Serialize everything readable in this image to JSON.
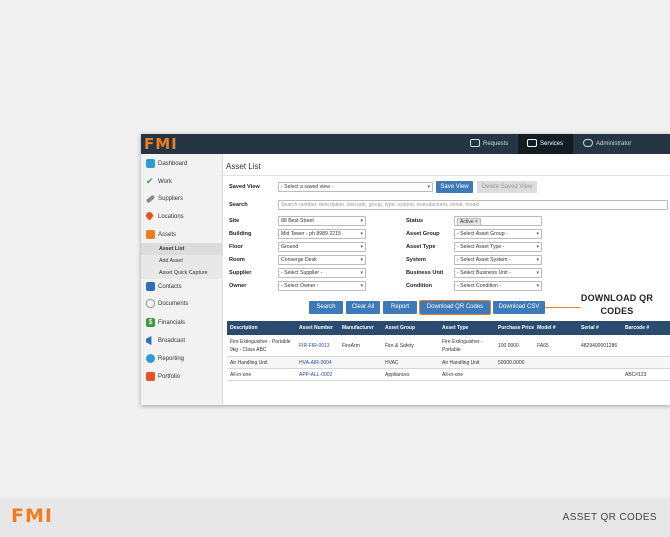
{
  "app": {
    "logo": "FMI",
    "nav": [
      {
        "label": "Requests",
        "icon": "camera-icon"
      },
      {
        "label": "Services",
        "icon": "heartbeat-icon"
      },
      {
        "label": "Administrator",
        "icon": "gear-icon"
      }
    ]
  },
  "sidebar": {
    "items": [
      {
        "label": "Dashboard",
        "icon": "dashboard-icon"
      },
      {
        "label": "Work",
        "icon": "checkmark-icon"
      },
      {
        "label": "Suppliers",
        "icon": "wrench-icon"
      },
      {
        "label": "Locations",
        "icon": "map-pin-icon"
      },
      {
        "label": "Assets",
        "icon": "assets-icon"
      },
      {
        "label": "Contacts",
        "icon": "contacts-icon"
      },
      {
        "label": "Documents",
        "icon": "paperclip-icon"
      },
      {
        "label": "Financials",
        "icon": "dollar-icon"
      },
      {
        "label": "Broadcast",
        "icon": "megaphone-icon"
      },
      {
        "label": "Reporting",
        "icon": "reporting-icon"
      },
      {
        "label": "Portfolio",
        "icon": "briefcase-icon"
      }
    ],
    "asset_subitems": [
      "Asset List",
      "Add Asset",
      "Asset Quick Capture"
    ]
  },
  "page": {
    "title": "Asset List",
    "saved_view": {
      "label": "Saved View",
      "placeholder": "- Select a saved view -"
    },
    "save_view_button": "Save View",
    "delete_saved_view_button": "Delete Saved View",
    "search": {
      "label": "Search",
      "placeholder": "Search number, description, barcode, group, type, system, manufacturer, serial, model"
    },
    "filters_left": [
      {
        "label": "Site",
        "value": "88 Best Street"
      },
      {
        "label": "Building",
        "value": "Mid Tower - ph 8989 2215"
      },
      {
        "label": "Floor",
        "value": "Ground"
      },
      {
        "label": "Room",
        "value": "Conserge Desk"
      },
      {
        "label": "Supplier",
        "value": "- Select Supplier -"
      },
      {
        "label": "Owner",
        "value": "- Select Owner -"
      }
    ],
    "status": {
      "label": "Status",
      "tag": "Active",
      "remove": "×"
    },
    "filters_right": [
      {
        "label": "Asset Group",
        "value": "- Select Asset Group -"
      },
      {
        "label": "Asset Type",
        "value": "- Select Asset Type -"
      },
      {
        "label": "System",
        "value": "- Select Asset System -"
      },
      {
        "label": "Business Unit",
        "value": "- Select Business Unit -"
      },
      {
        "label": "Condition",
        "value": "- Select Condition -"
      }
    ],
    "buttons": {
      "search": "Search",
      "clear_all": "Clear All",
      "report": "Report",
      "download_qr": "Download QR Codes",
      "download_csv": "Download CSV"
    }
  },
  "table": {
    "columns": [
      "Description",
      "Asset Number",
      "Manufacturer",
      "Asset Group",
      "Asset Type",
      "Purchase Price",
      "Model #",
      "Serial #",
      "Barcode #"
    ],
    "rows": [
      [
        "Fire Extinguisher - Portable 9kg - Class ABC",
        "FIR-FIR-0013",
        "FireArm",
        "Fire & Safety",
        "Fire Extinguisher - Portable",
        "100.0000",
        "FA65",
        "4829400001286",
        ""
      ],
      [
        "Air Handling Unit",
        "HVA-AIR-0004",
        "",
        "HVAC",
        "Air Handling Unit",
        "50000.0000",
        "",
        "",
        ""
      ],
      [
        "All-in-one",
        "APP-ALL-0002",
        "",
        "Appliances",
        "All-in-one",
        "",
        "",
        "",
        "ABC#123"
      ]
    ]
  },
  "callout": {
    "text": "DOWNLOAD QR CODES"
  },
  "footer": {
    "logo": "FMI",
    "caption": "ASSET QR CODES"
  },
  "colors": {
    "brand_orange": "#f07c22",
    "topbar": "#253544",
    "button_blue": "#3f7ab8",
    "table_header": "#2a4b6e"
  }
}
